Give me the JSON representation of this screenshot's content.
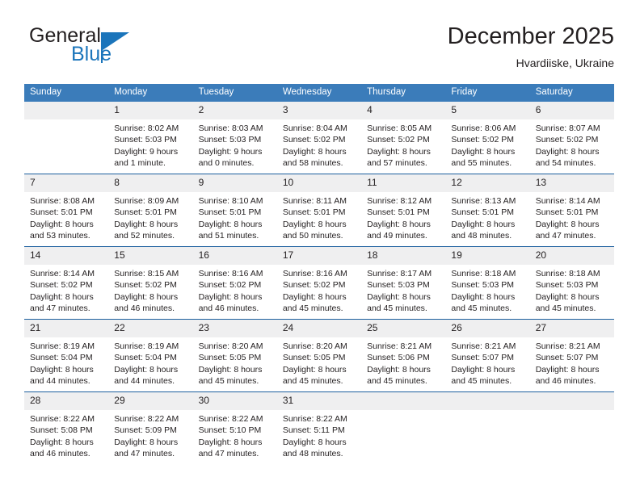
{
  "brand": {
    "name_part1": "General",
    "name_part2": "Blue"
  },
  "header": {
    "title": "December 2025",
    "subtitle": "Hvardiiske, Ukraine"
  },
  "calendar": {
    "weekday_headers": [
      "Sunday",
      "Monday",
      "Tuesday",
      "Wednesday",
      "Thursday",
      "Friday",
      "Saturday"
    ],
    "accent_color": "#3b7cba",
    "border_color": "#1c5f9e",
    "daynum_band_color": "#efeff0",
    "weeks": [
      [
        {
          "day": "",
          "lines": []
        },
        {
          "day": "1",
          "lines": [
            "Sunrise: 8:02 AM",
            "Sunset: 5:03 PM",
            "Daylight: 9 hours",
            "and 1 minute."
          ]
        },
        {
          "day": "2",
          "lines": [
            "Sunrise: 8:03 AM",
            "Sunset: 5:03 PM",
            "Daylight: 9 hours",
            "and 0 minutes."
          ]
        },
        {
          "day": "3",
          "lines": [
            "Sunrise: 8:04 AM",
            "Sunset: 5:02 PM",
            "Daylight: 8 hours",
            "and 58 minutes."
          ]
        },
        {
          "day": "4",
          "lines": [
            "Sunrise: 8:05 AM",
            "Sunset: 5:02 PM",
            "Daylight: 8 hours",
            "and 57 minutes."
          ]
        },
        {
          "day": "5",
          "lines": [
            "Sunrise: 8:06 AM",
            "Sunset: 5:02 PM",
            "Daylight: 8 hours",
            "and 55 minutes."
          ]
        },
        {
          "day": "6",
          "lines": [
            "Sunrise: 8:07 AM",
            "Sunset: 5:02 PM",
            "Daylight: 8 hours",
            "and 54 minutes."
          ]
        }
      ],
      [
        {
          "day": "7",
          "lines": [
            "Sunrise: 8:08 AM",
            "Sunset: 5:01 PM",
            "Daylight: 8 hours",
            "and 53 minutes."
          ]
        },
        {
          "day": "8",
          "lines": [
            "Sunrise: 8:09 AM",
            "Sunset: 5:01 PM",
            "Daylight: 8 hours",
            "and 52 minutes."
          ]
        },
        {
          "day": "9",
          "lines": [
            "Sunrise: 8:10 AM",
            "Sunset: 5:01 PM",
            "Daylight: 8 hours",
            "and 51 minutes."
          ]
        },
        {
          "day": "10",
          "lines": [
            "Sunrise: 8:11 AM",
            "Sunset: 5:01 PM",
            "Daylight: 8 hours",
            "and 50 minutes."
          ]
        },
        {
          "day": "11",
          "lines": [
            "Sunrise: 8:12 AM",
            "Sunset: 5:01 PM",
            "Daylight: 8 hours",
            "and 49 minutes."
          ]
        },
        {
          "day": "12",
          "lines": [
            "Sunrise: 8:13 AM",
            "Sunset: 5:01 PM",
            "Daylight: 8 hours",
            "and 48 minutes."
          ]
        },
        {
          "day": "13",
          "lines": [
            "Sunrise: 8:14 AM",
            "Sunset: 5:01 PM",
            "Daylight: 8 hours",
            "and 47 minutes."
          ]
        }
      ],
      [
        {
          "day": "14",
          "lines": [
            "Sunrise: 8:14 AM",
            "Sunset: 5:02 PM",
            "Daylight: 8 hours",
            "and 47 minutes."
          ]
        },
        {
          "day": "15",
          "lines": [
            "Sunrise: 8:15 AM",
            "Sunset: 5:02 PM",
            "Daylight: 8 hours",
            "and 46 minutes."
          ]
        },
        {
          "day": "16",
          "lines": [
            "Sunrise: 8:16 AM",
            "Sunset: 5:02 PM",
            "Daylight: 8 hours",
            "and 46 minutes."
          ]
        },
        {
          "day": "17",
          "lines": [
            "Sunrise: 8:16 AM",
            "Sunset: 5:02 PM",
            "Daylight: 8 hours",
            "and 45 minutes."
          ]
        },
        {
          "day": "18",
          "lines": [
            "Sunrise: 8:17 AM",
            "Sunset: 5:03 PM",
            "Daylight: 8 hours",
            "and 45 minutes."
          ]
        },
        {
          "day": "19",
          "lines": [
            "Sunrise: 8:18 AM",
            "Sunset: 5:03 PM",
            "Daylight: 8 hours",
            "and 45 minutes."
          ]
        },
        {
          "day": "20",
          "lines": [
            "Sunrise: 8:18 AM",
            "Sunset: 5:03 PM",
            "Daylight: 8 hours",
            "and 45 minutes."
          ]
        }
      ],
      [
        {
          "day": "21",
          "lines": [
            "Sunrise: 8:19 AM",
            "Sunset: 5:04 PM",
            "Daylight: 8 hours",
            "and 44 minutes."
          ]
        },
        {
          "day": "22",
          "lines": [
            "Sunrise: 8:19 AM",
            "Sunset: 5:04 PM",
            "Daylight: 8 hours",
            "and 44 minutes."
          ]
        },
        {
          "day": "23",
          "lines": [
            "Sunrise: 8:20 AM",
            "Sunset: 5:05 PM",
            "Daylight: 8 hours",
            "and 45 minutes."
          ]
        },
        {
          "day": "24",
          "lines": [
            "Sunrise: 8:20 AM",
            "Sunset: 5:05 PM",
            "Daylight: 8 hours",
            "and 45 minutes."
          ]
        },
        {
          "day": "25",
          "lines": [
            "Sunrise: 8:21 AM",
            "Sunset: 5:06 PM",
            "Daylight: 8 hours",
            "and 45 minutes."
          ]
        },
        {
          "day": "26",
          "lines": [
            "Sunrise: 8:21 AM",
            "Sunset: 5:07 PM",
            "Daylight: 8 hours",
            "and 45 minutes."
          ]
        },
        {
          "day": "27",
          "lines": [
            "Sunrise: 8:21 AM",
            "Sunset: 5:07 PM",
            "Daylight: 8 hours",
            "and 46 minutes."
          ]
        }
      ],
      [
        {
          "day": "28",
          "lines": [
            "Sunrise: 8:22 AM",
            "Sunset: 5:08 PM",
            "Daylight: 8 hours",
            "and 46 minutes."
          ]
        },
        {
          "day": "29",
          "lines": [
            "Sunrise: 8:22 AM",
            "Sunset: 5:09 PM",
            "Daylight: 8 hours",
            "and 47 minutes."
          ]
        },
        {
          "day": "30",
          "lines": [
            "Sunrise: 8:22 AM",
            "Sunset: 5:10 PM",
            "Daylight: 8 hours",
            "and 47 minutes."
          ]
        },
        {
          "day": "31",
          "lines": [
            "Sunrise: 8:22 AM",
            "Sunset: 5:11 PM",
            "Daylight: 8 hours",
            "and 48 minutes."
          ]
        },
        {
          "day": "",
          "lines": []
        },
        {
          "day": "",
          "lines": []
        },
        {
          "day": "",
          "lines": []
        }
      ]
    ]
  }
}
